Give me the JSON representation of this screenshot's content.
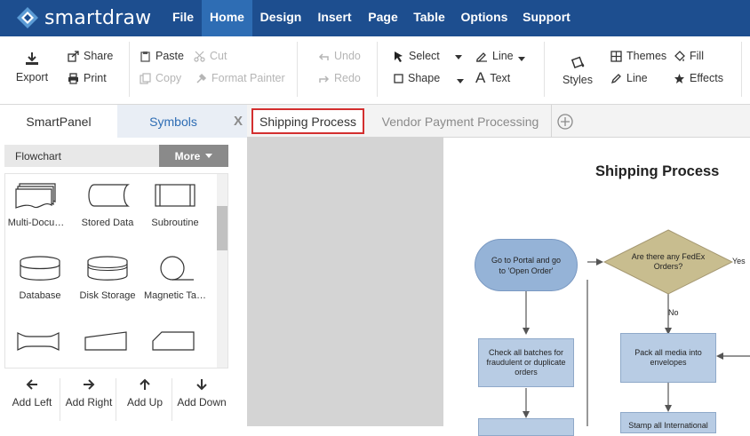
{
  "app": {
    "logo_text": "smartdraw"
  },
  "menu": [
    "File",
    "Home",
    "Design",
    "Insert",
    "Page",
    "Table",
    "Options",
    "Support"
  ],
  "ribbon": {
    "export": "Export",
    "share": "Share",
    "print": "Print",
    "paste": "Paste",
    "cut": "Cut",
    "copy": "Copy",
    "format_painter": "Format Painter",
    "undo": "Undo",
    "redo": "Redo",
    "select": "Select",
    "shape": "Shape",
    "line": "Line",
    "text": "Text",
    "styles": "Styles",
    "themes": "Themes",
    "fill": "Fill",
    "line2": "Line",
    "effects": "Effects"
  },
  "left_panel": {
    "tab_smartpanel": "SmartPanel",
    "tab_symbols": "Symbols",
    "close": "X",
    "library": "Flowchart",
    "more": "More",
    "shapes": [
      "Multi-Docu…",
      "Stored Data",
      "Subroutine",
      "Database",
      "Disk Storage",
      "Magnetic Ta…"
    ],
    "add_buttons": [
      "Add Left",
      "Add Right",
      "Add Up",
      "Add Down"
    ]
  },
  "doc_tabs": [
    "Shipping Process",
    "Vendor Payment Processing"
  ],
  "diagram": {
    "title": "Shipping Process",
    "node_portal": "Go to Portal and go to 'Open Order'",
    "node_check": "Check all batches for fraudulent or duplicate orders",
    "node_fedex": "Are there any FedEx Orders?",
    "node_pack": "Pack all media into envelopes",
    "node_stamp": "Stamp all International",
    "label_yes": "Yes",
    "label_no": "No"
  },
  "colors": {
    "brand_bar": "#1d4e8f",
    "active_menu": "#2e6db4",
    "tab_highlight": "#d32f2f",
    "node_blue": "#b8cce4",
    "node_oval": "#95b3d7",
    "decision": "#c8bd8f"
  }
}
